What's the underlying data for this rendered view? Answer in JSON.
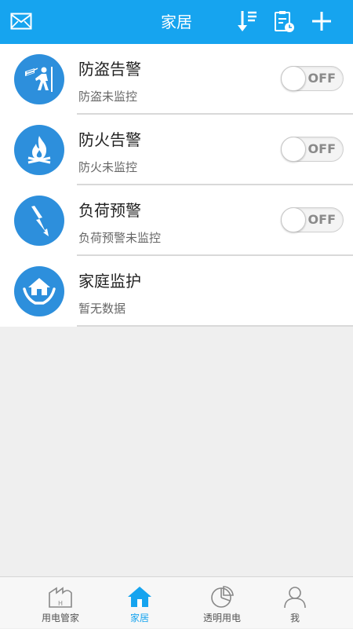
{
  "header": {
    "title": "家居"
  },
  "alarms": [
    {
      "title": "防盗告警",
      "subtitle": "防盗未监控",
      "toggle": "OFF",
      "icon": "burglar-icon"
    },
    {
      "title": "防火告警",
      "subtitle": "防火未监控",
      "toggle": "OFF",
      "icon": "fire-icon"
    },
    {
      "title": "负荷预警",
      "subtitle": "负荷预警未监控",
      "toggle": "OFF",
      "icon": "lightning-icon"
    },
    {
      "title": "家庭监护",
      "subtitle": "暂无数据",
      "icon": "home-care-icon"
    }
  ],
  "tabs": [
    {
      "label": "用电管家",
      "icon": "building-icon",
      "active": false
    },
    {
      "label": "家居",
      "icon": "home-icon",
      "active": true
    },
    {
      "label": "透明用电",
      "icon": "pie-chart-icon",
      "active": false
    },
    {
      "label": "我",
      "icon": "user-icon",
      "active": false
    }
  ],
  "colors": {
    "primary": "#16a4ef",
    "avatar": "#2d8fdc",
    "background": "#efefef"
  }
}
